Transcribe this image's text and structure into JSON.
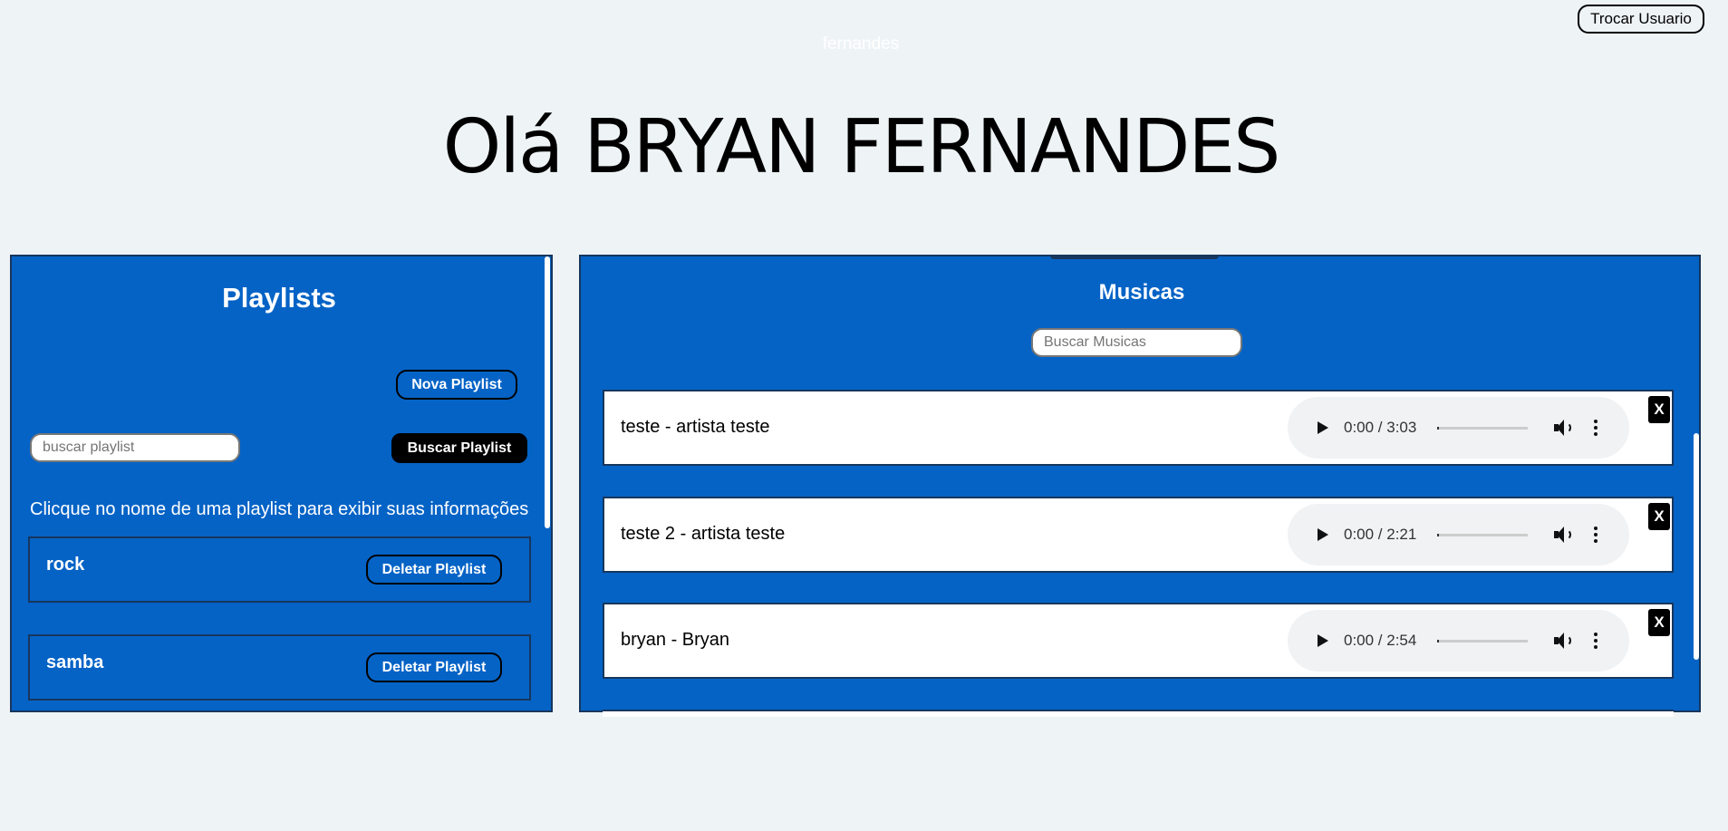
{
  "header": {
    "switch_user_label": "Trocar Usuario",
    "username": "fernandes",
    "greeting": "Olá BRYAN FERNANDES"
  },
  "playlists": {
    "title": "Playlists",
    "new_button": "Nova Playlist",
    "search_placeholder": "buscar playlist",
    "search_button": "Buscar Playlist",
    "hint": "Clicque no nome de uma playlist para exibir suas informações",
    "delete_label": "Deletar Playlist",
    "items": [
      {
        "name": "rock"
      },
      {
        "name": "samba"
      }
    ]
  },
  "musics": {
    "title": "Musicas",
    "search_placeholder": "Buscar Musicas",
    "delete_label": "X",
    "tracks": [
      {
        "name": "teste - artista teste",
        "time": "0:00 / 3:03"
      },
      {
        "name": "teste 2 - artista teste",
        "time": "0:00 / 2:21"
      },
      {
        "name": "bryan - Bryan",
        "time": "0:00 / 2:54"
      }
    ]
  },
  "colors": {
    "panel_blue": "#0563c6",
    "page_bg": "#eef3f6"
  }
}
